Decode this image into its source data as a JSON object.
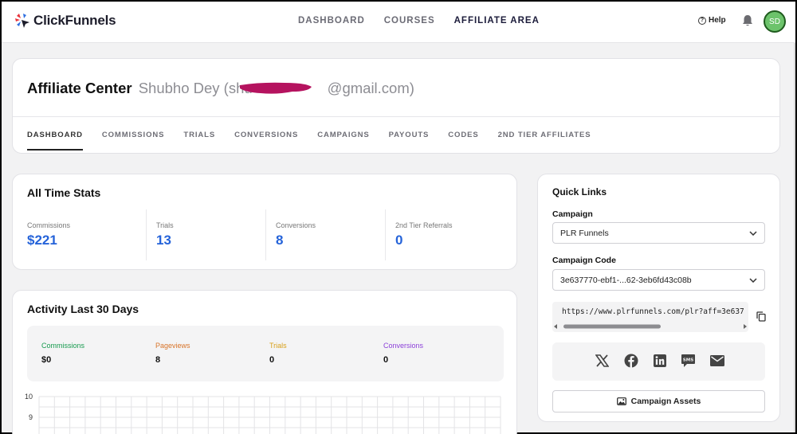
{
  "brand": {
    "name": "ClickFunnels"
  },
  "nav": {
    "links": [
      "DASHBOARD",
      "COURSES",
      "AFFILIATE AREA"
    ],
    "help": "Help",
    "avatar_initials": "SD"
  },
  "header": {
    "title": "Affiliate Center",
    "user_prefix": "Shubho Dey (shu",
    "user_suffix": "@gmail.com)"
  },
  "tabs": [
    "DASHBOARD",
    "COMMISSIONS",
    "TRIALS",
    "CONVERSIONS",
    "CAMPAIGNS",
    "PAYOUTS",
    "CODES",
    "2ND TIER AFFILIATES"
  ],
  "stats": {
    "title": "All Time Stats",
    "items": [
      {
        "label": "Commissions",
        "value": "$221"
      },
      {
        "label": "Trials",
        "value": "13"
      },
      {
        "label": "Conversions",
        "value": "8"
      },
      {
        "label": "2nd Tier Referrals",
        "value": "0"
      }
    ]
  },
  "activity": {
    "title": "Activity Last 30 Days",
    "legend": [
      {
        "label": "Commissions",
        "value": "$0",
        "color": "#169a4e"
      },
      {
        "label": "Pageviews",
        "value": "8",
        "color": "#d8742a"
      },
      {
        "label": "Trials",
        "value": "0",
        "color": "#d8a019"
      },
      {
        "label": "Conversions",
        "value": "0",
        "color": "#8b3fd9"
      }
    ],
    "y_ticks": [
      "10",
      "9"
    ]
  },
  "quick_links": {
    "title": "Quick Links",
    "campaign_label": "Campaign",
    "campaign_value": "PLR Funnels",
    "code_label": "Campaign Code",
    "code_value": "3e637770-ebf1-...62-3eb6fd43c08b",
    "url": "https://www.plrfunnels.com/plr?aff=3e637",
    "assets_button": "Campaign Assets"
  },
  "colors": {
    "accent_blue": "#2563d9",
    "redaction": "#b5135f",
    "avatar_green": "#6cc36b"
  }
}
